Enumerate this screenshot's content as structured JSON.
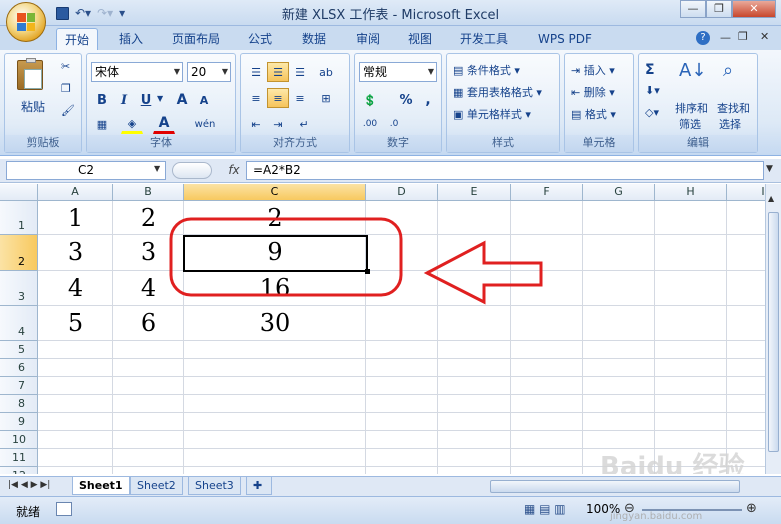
{
  "window": {
    "title": "新建 XLSX 工作表 - Microsoft Excel"
  },
  "tabs": [
    "开始",
    "插入",
    "页面布局",
    "公式",
    "数据",
    "审阅",
    "视图",
    "开发工具",
    "WPS PDF"
  ],
  "ribbon": {
    "clipboard": {
      "label": "剪贴板",
      "paste": "粘贴"
    },
    "font": {
      "label": "字体",
      "name": "宋体",
      "size": "20",
      "bold": "B",
      "italic": "I",
      "underline": "U",
      "grow": "A",
      "shrink": "A",
      "font_color_glyph": "A",
      "phonetic": "wén"
    },
    "alignment": {
      "label": "对齐方式"
    },
    "number": {
      "label": "数字",
      "format": "常规",
      "percent": "%",
      "comma": ",",
      "inc_decimal": ".00",
      "dec_decimal": ".0"
    },
    "styles": {
      "label": "样式",
      "conditional": "条件格式",
      "table": "套用表格格式",
      "cell": "单元格样式"
    },
    "cells": {
      "label": "单元格",
      "insert": "插入",
      "delete": "删除",
      "format": "格式"
    },
    "editing": {
      "label": "编辑",
      "sort_line1": "排序和",
      "sort_line2": "筛选",
      "find_line1": "查找和",
      "find_line2": "选择",
      "sigma": "Σ"
    }
  },
  "formula_bar": {
    "name_box": "C2",
    "fx": "fx",
    "formula": "=A2*B2"
  },
  "columns": [
    "A",
    "B",
    "C",
    "D",
    "E",
    "F",
    "G",
    "H",
    "I"
  ],
  "rows": [
    "1",
    "2",
    "3",
    "4",
    "5",
    "6",
    "7",
    "8",
    "9",
    "10",
    "11",
    "12"
  ],
  "cells": {
    "A1": "1",
    "B1": "2",
    "C1": "2",
    "A2": "3",
    "B2": "3",
    "C2": "9",
    "A3": "4",
    "B3": "4",
    "C3": "16",
    "A4": "5",
    "B4": "6",
    "C4": "30"
  },
  "sheets": [
    "Sheet1",
    "Sheet2",
    "Sheet3"
  ],
  "status": {
    "ready": "就绪",
    "zoom": "100%"
  },
  "annotation": {
    "color": "#e02020"
  },
  "watermark": {
    "text": "Baidu 经验",
    "url": "jingyan.baidu.com"
  }
}
